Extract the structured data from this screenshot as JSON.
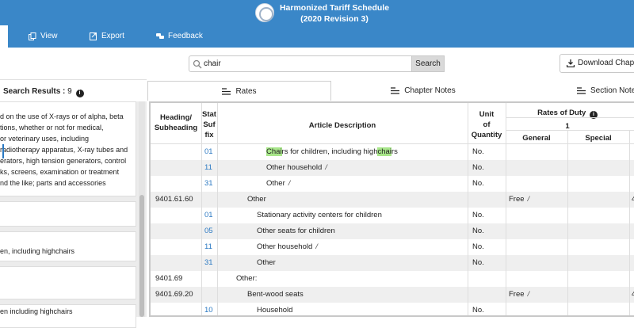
{
  "header": {
    "title_line1": "Harmonized Tariff Schedule",
    "title_line2": "(2020 Revision 3)"
  },
  "toolbar": {
    "view": "View",
    "export": "Export",
    "feedback": "Feedback"
  },
  "search": {
    "value": "chair",
    "button": "Search"
  },
  "download": {
    "label": "Download Chapter"
  },
  "results": {
    "label": "Search Results :",
    "count": "9"
  },
  "tabs": {
    "rates": "Rates",
    "chapter_notes": "Chapter Notes",
    "section_notes": "Section Notes"
  },
  "left_cards": {
    "card1": [
      "d on the use of X-rays or of alpha, beta",
      "tions, whether or not for medical,",
      "or veterinary uses, including",
      "radiotherapy apparatus, X-ray tubes and",
      "erators, high tension generators, control",
      "ks, screens, examination or treatment",
      "nd the like; parts and accessories"
    ],
    "card3": "en, including highchairs",
    "card5": "en including highchairs"
  },
  "table": {
    "headers": {
      "heading": [
        "Heading/",
        "Subheading"
      ],
      "stat": [
        "Stat",
        "Suf",
        "fix"
      ],
      "description": "Article Description",
      "unit": [
        "Unit",
        "of",
        "Quantity"
      ],
      "rates": "Rates of Duty",
      "col1": "1",
      "general": "General",
      "special": "Special"
    },
    "rows": [
      {
        "heading": "",
        "stat": "01",
        "desc_pre": "",
        "desc_hl1": "Chai",
        "desc_mid": "rs for children, including high",
        "desc_hl2": "chai",
        "desc_post": "rs",
        "unit": "No.",
        "general": "",
        "foot": "",
        "gfoot": "",
        "col2": ""
      },
      {
        "heading": "",
        "stat": "11",
        "desc": "Other household",
        "foot": "/",
        "unit": "No.",
        "general": "",
        "gfoot": "",
        "col2": ""
      },
      {
        "heading": "",
        "stat": "31",
        "desc": "Other",
        "foot": "/",
        "unit": "No.",
        "general": "",
        "gfoot": "",
        "col2": ""
      },
      {
        "heading": "9401.61.60",
        "stat": "",
        "desc": "Other",
        "foot": "",
        "unit": "",
        "general": "Free",
        "gfoot": "/",
        "col2": "4"
      },
      {
        "heading": "",
        "stat": "01",
        "desc": "Stationary activity centers for children",
        "foot": "",
        "unit": "No.",
        "general": "",
        "gfoot": "",
        "col2": ""
      },
      {
        "heading": "",
        "stat": "05",
        "desc": "Other seats for children",
        "foot": "",
        "unit": "No.",
        "general": "",
        "gfoot": "",
        "col2": ""
      },
      {
        "heading": "",
        "stat": "11",
        "desc": "Other household",
        "foot": "/",
        "unit": "No.",
        "general": "",
        "gfoot": "",
        "col2": ""
      },
      {
        "heading": "",
        "stat": "31",
        "desc": "Other",
        "foot": "",
        "unit": "No.",
        "general": "",
        "gfoot": "",
        "col2": ""
      },
      {
        "heading": "9401.69",
        "stat": "",
        "desc": "Other:",
        "foot": "",
        "unit": "",
        "general": "",
        "gfoot": "",
        "col2": ""
      },
      {
        "heading": "9401.69.20",
        "stat": "",
        "desc": "Bent-wood seats",
        "foot": "",
        "unit": "",
        "general": "Free",
        "gfoot": "/",
        "col2": "4"
      },
      {
        "heading": "",
        "stat": "10",
        "desc": "Household",
        "foot": "",
        "unit": "No.",
        "general": "",
        "gfoot": "",
        "col2": ""
      }
    ]
  },
  "colors": {
    "header_blue": "#3a87c8",
    "link_blue": "#2a78c2",
    "highlight_green": "#a8e68a"
  }
}
